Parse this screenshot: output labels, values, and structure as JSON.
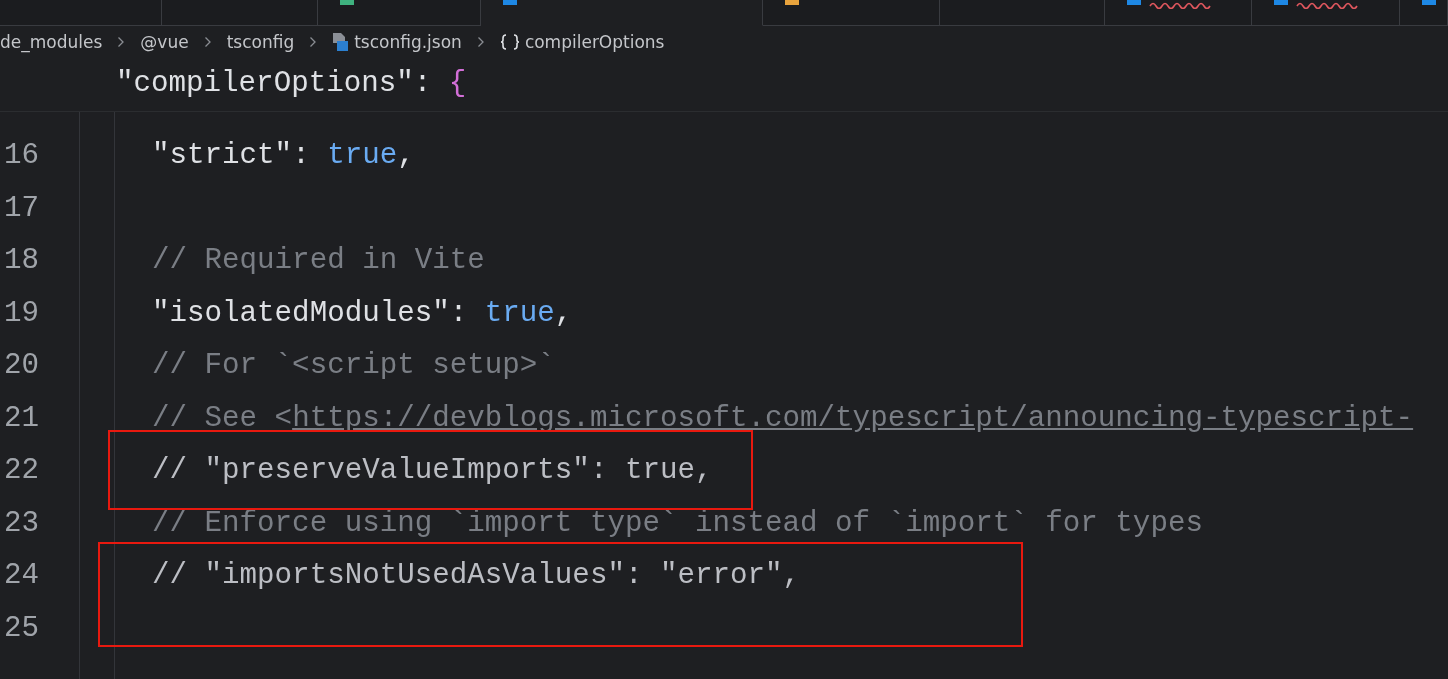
{
  "tabs": [
    {
      "selected": false
    },
    {
      "selected": false
    },
    {
      "selected": false,
      "color": "#3fb27f"
    },
    {
      "selected": true,
      "color": "#1e88e5"
    },
    {
      "selected": false,
      "color": "#e8a33d"
    },
    {
      "selected": false
    },
    {
      "selected": false,
      "color": "#1e88e5",
      "error": true
    },
    {
      "selected": false,
      "color": "#1e88e5",
      "error": true
    },
    {
      "selected": false,
      "color": "#1e88e5"
    }
  ],
  "breadcrumb": [
    {
      "text": "de_modules",
      "kind": "folder"
    },
    {
      "text": "@vue",
      "kind": "folder"
    },
    {
      "text": "tsconfig",
      "kind": "folder"
    },
    {
      "text": "tsconfig.json",
      "kind": "file"
    },
    {
      "text": "compilerOptions",
      "kind": "object"
    }
  ],
  "sticky_line": {
    "tokens": [
      {
        "text": "\"compilerOptions\"",
        "kind": "key"
      },
      {
        "text": ": ",
        "kind": "punct"
      },
      {
        "text": "{",
        "kind": "brace"
      }
    ]
  },
  "lines": [
    {
      "number": "16",
      "tokens": [
        {
          "text": "\"strict\"",
          "kind": "key"
        },
        {
          "text": ": ",
          "kind": "punct"
        },
        {
          "text": "true",
          "kind": "bool"
        },
        {
          "text": ",",
          "kind": "punct"
        }
      ]
    },
    {
      "number": "17"
    },
    {
      "number": "18",
      "tokens": [
        {
          "text": "// Required in Vite",
          "kind": "comment"
        }
      ]
    },
    {
      "number": "19",
      "tokens": [
        {
          "text": "\"isolatedModules\"",
          "kind": "key"
        },
        {
          "text": ": ",
          "kind": "punct"
        },
        {
          "text": "true",
          "kind": "bool"
        },
        {
          "text": ",",
          "kind": "punct"
        }
      ]
    },
    {
      "number": "20",
      "tokens": [
        {
          "text": "// For `<script setup>`",
          "kind": "comment"
        }
      ]
    },
    {
      "number": "21",
      "tokens": [
        {
          "text": "// See <",
          "kind": "comment"
        },
        {
          "text": "https://devblogs.microsoft.com/typescript/announcing-typescript-",
          "kind": "link"
        }
      ]
    },
    {
      "number": "22",
      "tokens": [
        {
          "text": "// \"preserveValueImports\": true,",
          "kind": "comment_light"
        }
      ]
    },
    {
      "number": "23",
      "tokens": [
        {
          "text": "// Enforce using `import type` instead of `import` for types",
          "kind": "comment"
        }
      ]
    },
    {
      "number": "24",
      "tokens": [
        {
          "text": "// \"importsNotUsedAsValues\": \"error\",",
          "kind": "comment_light"
        }
      ]
    },
    {
      "number": "25"
    }
  ]
}
